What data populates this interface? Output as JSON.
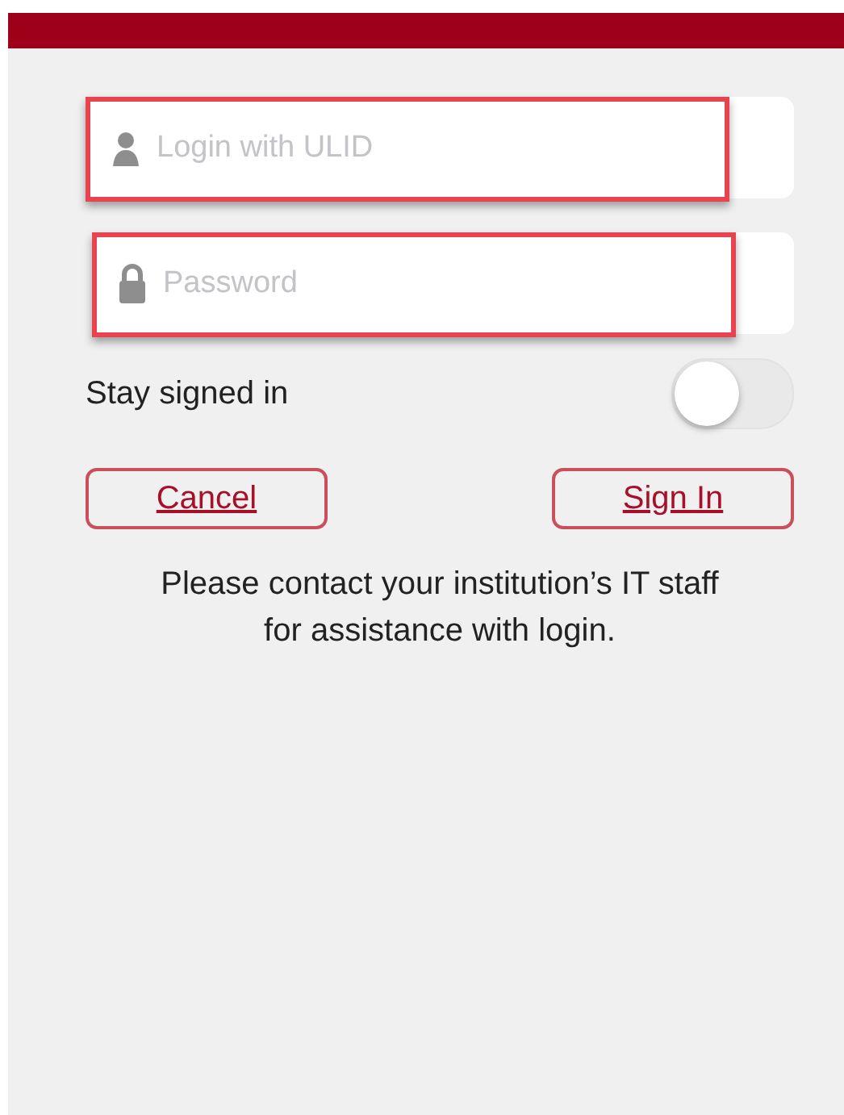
{
  "fields": [
    {
      "kind": "user",
      "placeholder": "Login with ULID",
      "highlighted": true
    },
    {
      "kind": "password",
      "placeholder": "Password",
      "highlighted": true
    }
  ],
  "stay_signed_in": {
    "label": "Stay signed in",
    "on": false
  },
  "buttons": [
    "Cancel",
    "Sign In"
  ],
  "help_text": "Please contact your institution’s IT staff for assistance with login."
}
